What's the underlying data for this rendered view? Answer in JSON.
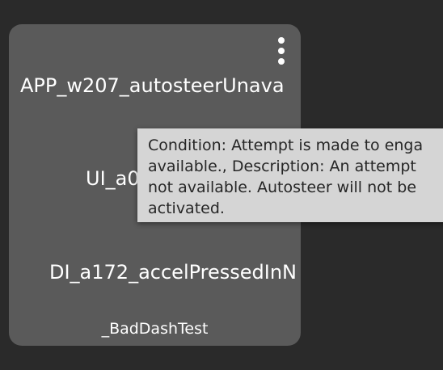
{
  "card": {
    "title_line": "APP_w207_autosteerUnava",
    "mid_line": "UI_a0",
    "accel_line": "DI_a172_accelPressedInN",
    "footer_label": "_BadDashTest",
    "menu_icon": "more-vertical-icon"
  },
  "tooltip": {
    "text": "Condition: Attempt is made to enga\navailable., Description: An attempt\nnot available. Autosteer will not be\nactivated."
  },
  "colors": {
    "background": "#2a2a2a",
    "card": "#5a5a5a",
    "tooltip": "#d5d5d5",
    "text_light": "#ffffff",
    "text_dark": "#262626"
  }
}
